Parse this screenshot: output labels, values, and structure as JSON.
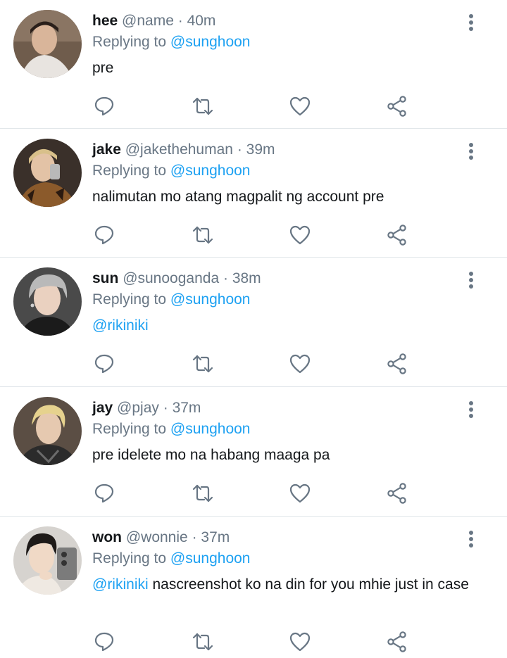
{
  "colors": {
    "name": "#14171a",
    "muted": "#687684",
    "link": "#1da1f2",
    "divider": "#e1e6ea"
  },
  "icons": {
    "reply": "reply-icon",
    "retweet": "retweet-icon",
    "like": "heart-icon",
    "share": "share-icon",
    "more": "more-vertical-icon"
  },
  "tweets": [
    {
      "name": "hee",
      "handle": "@name",
      "sep": "·",
      "time": "40m",
      "replying_prefix": "Replying to",
      "replying_to": "@sunghoon",
      "mention": "",
      "text": "pre"
    },
    {
      "name": "jake",
      "handle": "@jakethehuman",
      "sep": "·",
      "time": "39m",
      "replying_prefix": "Replying to",
      "replying_to": "@sunghoon",
      "mention": "",
      "text": "nalimutan mo atang magpalit ng account pre"
    },
    {
      "name": "sun",
      "handle": "@sunooganda",
      "sep": "·",
      "time": "38m",
      "replying_prefix": "Replying to",
      "replying_to": "@sunghoon",
      "mention": "@rikiniki",
      "text": ""
    },
    {
      "name": "jay",
      "handle": "@pjay",
      "sep": "·",
      "time": "37m",
      "replying_prefix": "Replying to",
      "replying_to": "@sunghoon",
      "mention": "",
      "text": "pre idelete mo na habang maaga pa"
    },
    {
      "name": "won",
      "handle": "@wonnie",
      "sep": "·",
      "time": "37m",
      "replying_prefix": "Replying to",
      "replying_to": "@sunghoon",
      "mention": "@rikiniki",
      "text": "nascreenshot ko na din for you mhie just in case"
    }
  ]
}
